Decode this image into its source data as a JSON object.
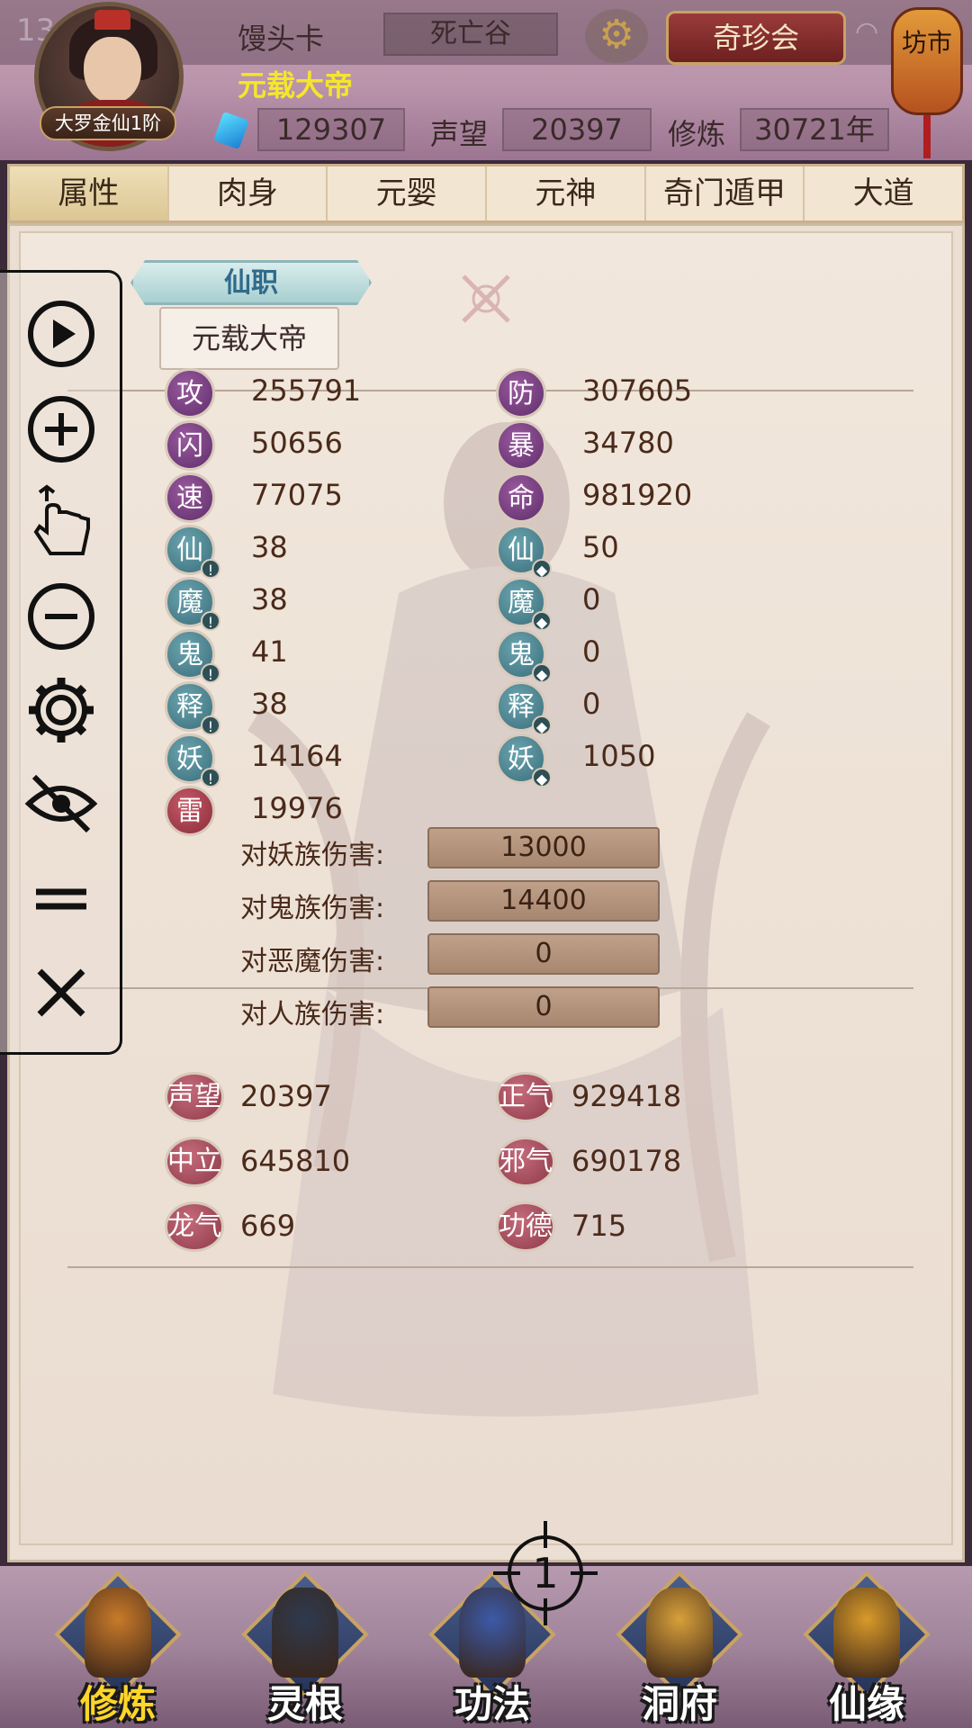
{
  "header": {
    "status_time": "13:36",
    "player_id": "馒头卡",
    "area": "死亡谷",
    "player_title": "元载大帝",
    "rank_badge": "大罗金仙1阶",
    "market_button": "奇珍会",
    "lantern_text": "坊市",
    "gems": "129307",
    "reputation_label": "声望",
    "reputation": "20397",
    "cultivation_label": "修炼",
    "cultivation": "30721年"
  },
  "tabs": [
    "属性",
    "肉身",
    "元婴",
    "元神",
    "奇门遁甲",
    "大道"
  ],
  "rank": {
    "section_title": "仙职",
    "value": "元载大帝"
  },
  "stats_left": [
    {
      "icon": "攻",
      "value": "255791",
      "color": "purple"
    },
    {
      "icon": "闪",
      "value": "50656",
      "color": "purple"
    },
    {
      "icon": "速",
      "value": "77075",
      "color": "purple"
    },
    {
      "icon": "仙",
      "value": "38",
      "color": "teal"
    },
    {
      "icon": "魔",
      "value": "38",
      "color": "teal"
    },
    {
      "icon": "鬼",
      "value": "41",
      "color": "teal"
    },
    {
      "icon": "释",
      "value": "38",
      "color": "teal"
    },
    {
      "icon": "妖",
      "value": "14164",
      "color": "teal"
    },
    {
      "icon": "雷",
      "value": "19976",
      "color": "red"
    }
  ],
  "stats_right": [
    {
      "icon": "防",
      "value": "307605",
      "color": "purple"
    },
    {
      "icon": "暴",
      "value": "34780",
      "color": "purple"
    },
    {
      "icon": "命",
      "value": "981920",
      "color": "purple"
    },
    {
      "icon": "仙",
      "value": "50",
      "color": "teal"
    },
    {
      "icon": "魔",
      "value": "0",
      "color": "teal"
    },
    {
      "icon": "鬼",
      "value": "0",
      "color": "teal"
    },
    {
      "icon": "释",
      "value": "0",
      "color": "teal"
    },
    {
      "icon": "妖",
      "value": "1050",
      "color": "teal"
    }
  ],
  "damage": [
    {
      "label": "对妖族伤害:",
      "value": "13000"
    },
    {
      "label": "对鬼族伤害:",
      "value": "14400"
    },
    {
      "label": "对恶魔伤害:",
      "value": "0"
    },
    {
      "label": "对人族伤害:",
      "value": "0"
    }
  ],
  "reputation_stats": [
    {
      "label": "声望",
      "value": "20397"
    },
    {
      "label": "正气",
      "value": "929418"
    },
    {
      "label": "中立",
      "value": "645810"
    },
    {
      "label": "邪气",
      "value": "690178"
    },
    {
      "label": "龙气",
      "value": "669"
    },
    {
      "label": "功德",
      "value": "715"
    }
  ],
  "toolbar": [
    "play-icon",
    "plus-circle-icon",
    "swipe-hand-icon",
    "minus-circle-icon",
    "gear-icon",
    "eye-off-icon",
    "double-line-icon",
    "close-icon"
  ],
  "crosshair_label": "1",
  "bottom_nav": [
    {
      "label": "修炼",
      "active": true
    },
    {
      "label": "灵根",
      "active": false
    },
    {
      "label": "功法",
      "active": false
    },
    {
      "label": "洞府",
      "active": false
    },
    {
      "label": "仙缘",
      "active": false
    }
  ],
  "colors": {
    "title_yellow": "#f5e62a",
    "stat_purple": "#5e2d6a",
    "stat_teal": "#3a6e7c",
    "stat_red": "#8a2c3a",
    "nav_active": "#ffd52a"
  }
}
